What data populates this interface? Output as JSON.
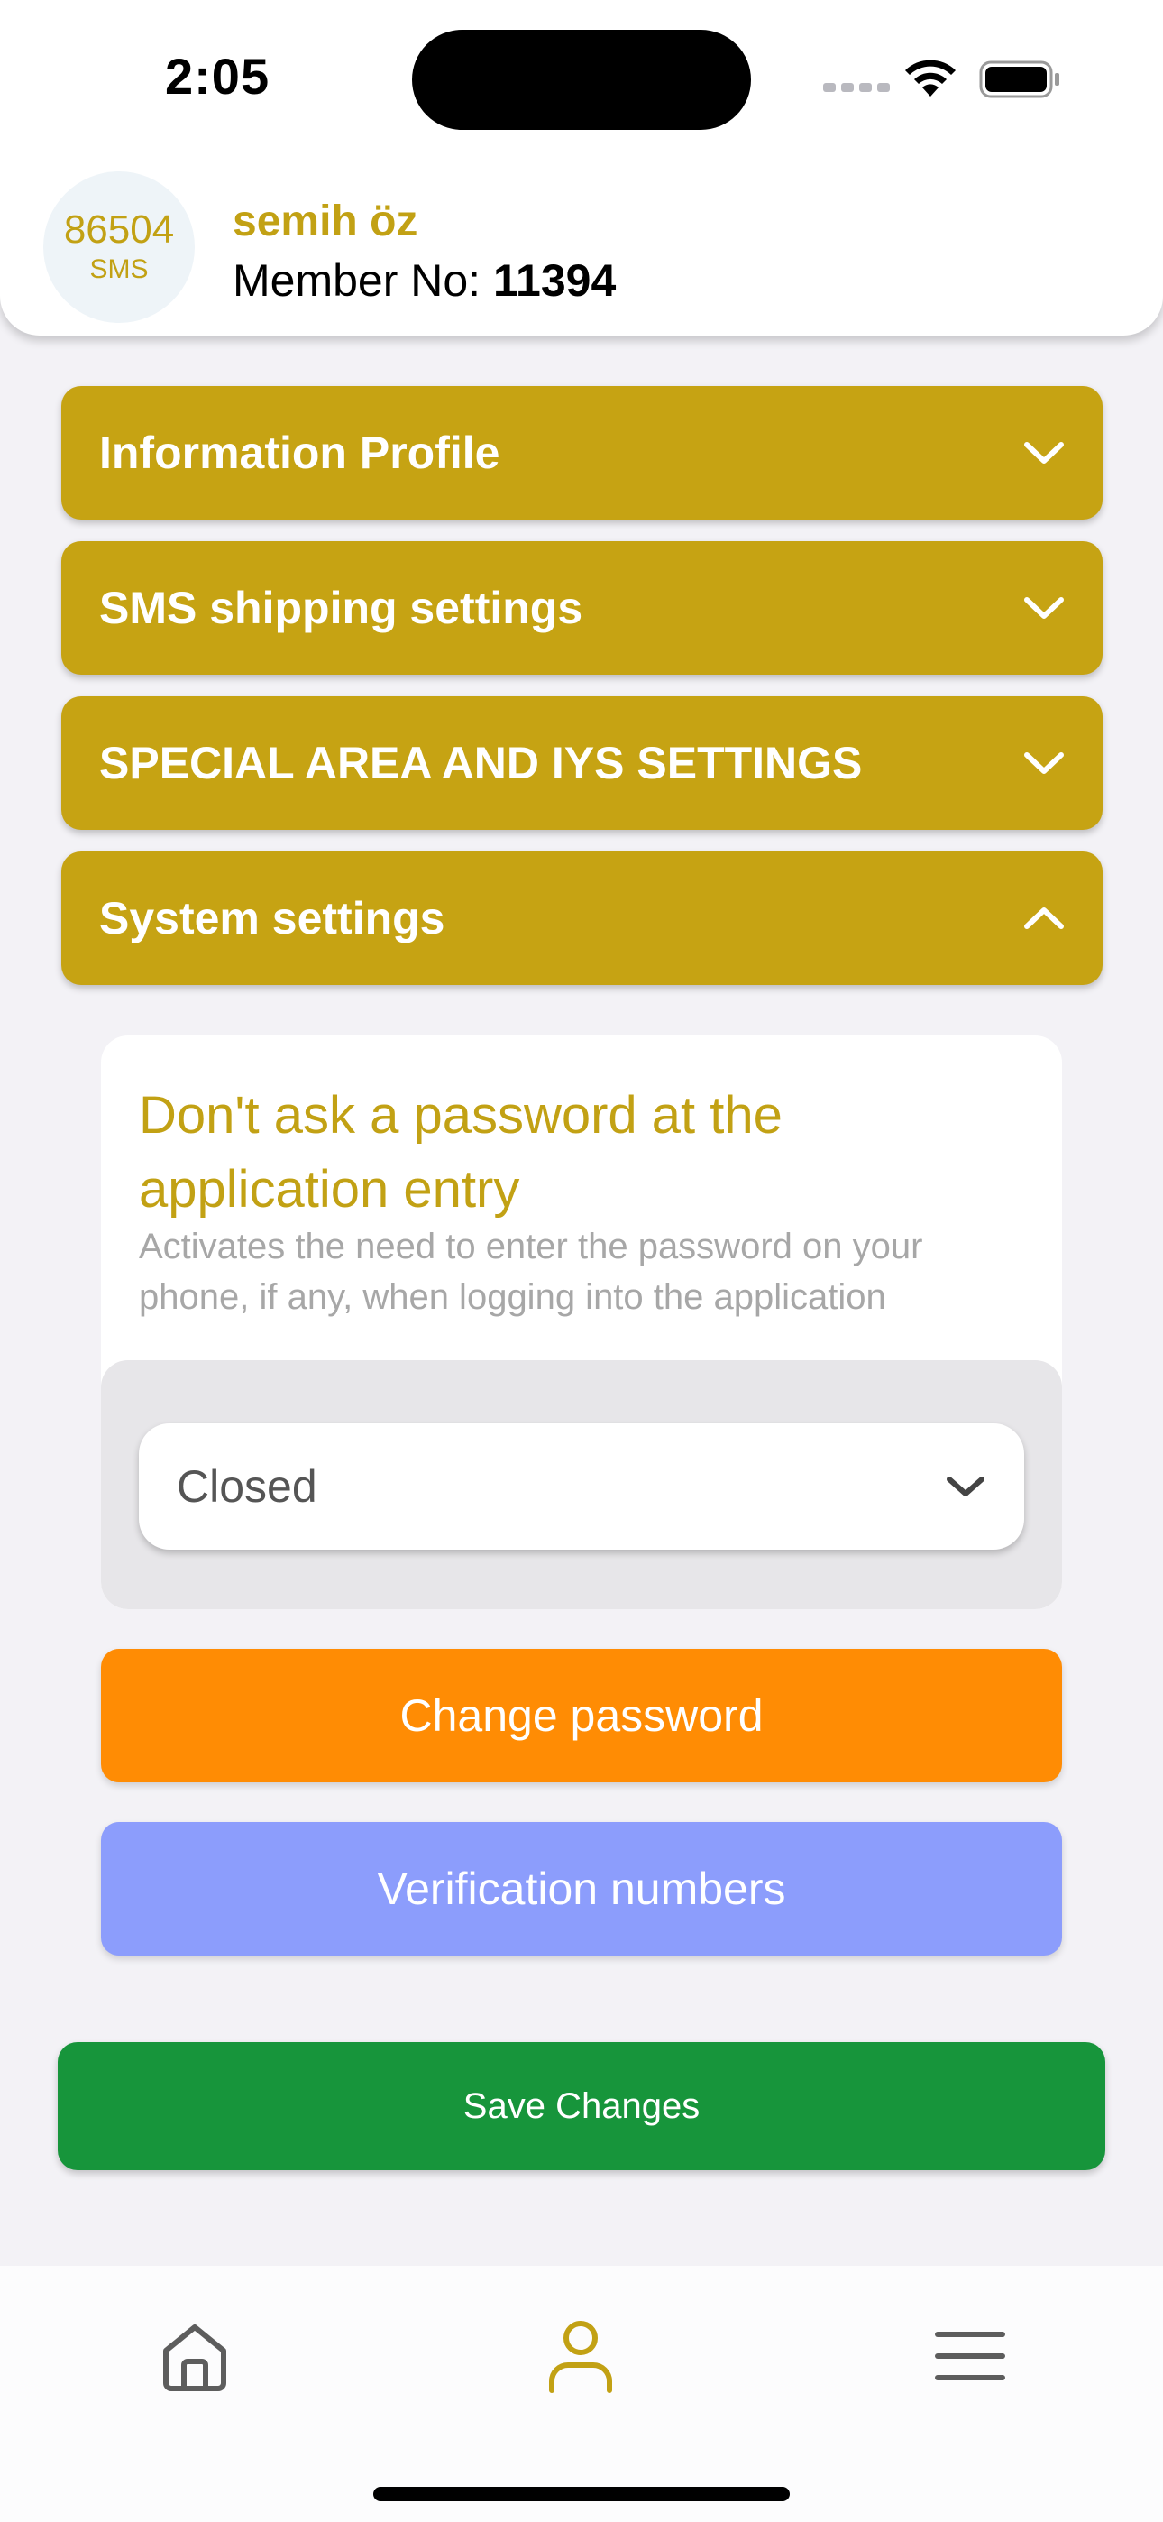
{
  "status_bar": {
    "time": "2:05"
  },
  "header": {
    "credits": "86504",
    "credits_unit": "SMS",
    "user_name": "semih öz",
    "member_label": "Member No:",
    "member_number": "11394"
  },
  "sections": [
    {
      "label": "Information Profile",
      "expanded": false
    },
    {
      "label": "SMS shipping settings",
      "expanded": false
    },
    {
      "label": "SPECIAL AREA AND IYS SETTINGS",
      "expanded": false
    },
    {
      "label": "System settings",
      "expanded": true
    }
  ],
  "system_settings": {
    "title": "Don't ask a password at the application entry",
    "description": "Activates the need to enter the password on your phone, if any, when logging into the application",
    "select_value": "Closed",
    "change_password_label": "Change password",
    "verification_numbers_label": "Verification numbers"
  },
  "save_label": "Save Changes",
  "tabbar": {
    "items": [
      {
        "icon": "home-icon",
        "active": false
      },
      {
        "icon": "user-icon",
        "active": true
      },
      {
        "icon": "menu-icon",
        "active": false
      }
    ]
  },
  "colors": {
    "accent": "#c6a313",
    "orange": "#ff8c04",
    "blue": "#8c9dfc",
    "green": "#17953b"
  }
}
